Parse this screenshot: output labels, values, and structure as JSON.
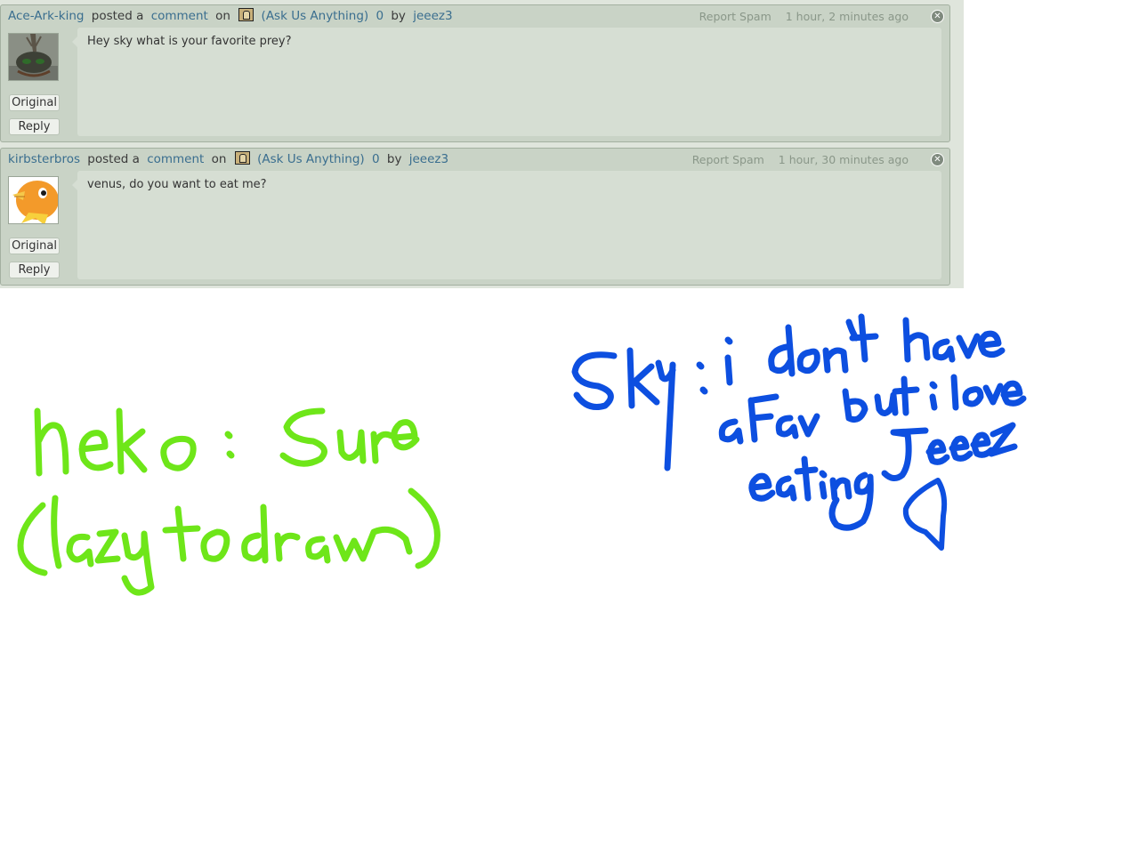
{
  "comments": [
    {
      "author": "Ace-Ark-king",
      "posted_a": "posted a",
      "comment_link": "comment",
      "on": "on",
      "group": "(Ask Us Anything)",
      "count": "0",
      "by": "by",
      "owner": "jeeez3",
      "report": "Report Spam",
      "time": "1 hour, 2 minutes ago",
      "text": "Hey sky what is your favorite prey?",
      "original_label": "Original",
      "reply_label": "Reply"
    },
    {
      "author": "kirbsterbros",
      "posted_a": "posted a",
      "comment_link": "comment",
      "on": "on",
      "group": "(Ask Us Anything)",
      "count": "0",
      "by": "by",
      "owner": "jeeez3",
      "report": "Report Spam",
      "time": "1 hour, 30 minutes ago",
      "text": "venus, do you want to eat me?",
      "original_label": "Original",
      "reply_label": "Reply"
    }
  ],
  "handwriting": {
    "neko_line1": "neko: Sure",
    "neko_line2": "(lazy to draw)",
    "sky_line1": "Sky: i don't have",
    "sky_line2": "a Fav but i love",
    "sky_line3": "eating Jeeez",
    "neko_color": "#6ee619",
    "sky_color": "#0d4fe0"
  },
  "icons": {
    "close": "close-icon",
    "group": "group-icon"
  }
}
